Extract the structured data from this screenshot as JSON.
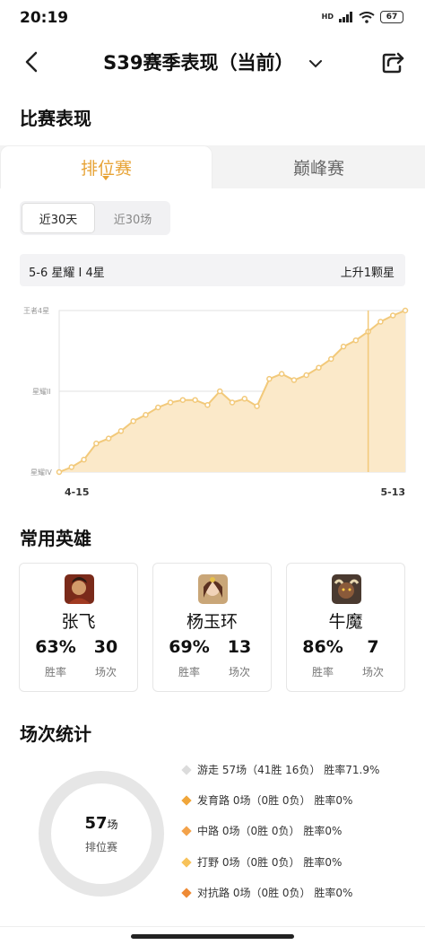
{
  "status": {
    "time": "20:19",
    "hd": "HD",
    "battery": "67"
  },
  "nav": {
    "title": "S39赛季表现（当前）"
  },
  "sections": {
    "performance": "比赛表现",
    "heroes": "常用英雄",
    "stats": "场次统计"
  },
  "tabs": [
    {
      "label": "排位赛",
      "active": true
    },
    {
      "label": "巅峰赛",
      "active": false
    }
  ],
  "range": [
    {
      "label": "近30天",
      "active": true
    },
    {
      "label": "近30场",
      "active": false
    }
  ],
  "rank": {
    "left": "5-6 星耀 I 4星",
    "right": "上升1颗星"
  },
  "chart_data": {
    "type": "area",
    "y_tick_labels": [
      "王者4星",
      "星耀II",
      "星耀IV"
    ],
    "x_tick_labels": [
      "4-15",
      "5-13"
    ],
    "values": [
      0,
      0.4,
      1,
      2.3,
      2.7,
      3.3,
      4.1,
      4.6,
      5.2,
      5.6,
      5.8,
      5.8,
      5.4,
      6.5,
      5.6,
      5.9,
      5.3,
      7.5,
      7.9,
      7.4,
      7.8,
      8.4,
      9.1,
      10.1,
      10.6,
      11.3,
      12.1,
      12.6,
      13
    ],
    "highlight_index": 25,
    "ylim": [
      0,
      13
    ],
    "grid": true
  },
  "heroes": [
    {
      "name": "张飞",
      "winrate": "63%",
      "games": "30",
      "winrate_label": "胜率",
      "games_label": "场次"
    },
    {
      "name": "杨玉环",
      "winrate": "69%",
      "games": "13",
      "winrate_label": "胜率",
      "games_label": "场次"
    },
    {
      "name": "牛魔",
      "winrate": "86%",
      "games": "7",
      "winrate_label": "胜率",
      "games_label": "场次"
    }
  ],
  "summary": {
    "count": "57",
    "unit": "场",
    "label": "排位赛"
  },
  "roles": [
    {
      "text": "游走 57场（41胜 16负） 胜率71.9%",
      "color": "#dcdcdc"
    },
    {
      "text": "发育路 0场（0胜 0负） 胜率0%",
      "color": "#f0a63a"
    },
    {
      "text": "中路 0场（0胜 0负） 胜率0%",
      "color": "#f3a24a"
    },
    {
      "text": "打野 0场（0胜 0负） 胜率0%",
      "color": "#f7c25a"
    },
    {
      "text": "对抗路 0场（0胜 0负） 胜率0%",
      "color": "#ee8a35"
    }
  ]
}
